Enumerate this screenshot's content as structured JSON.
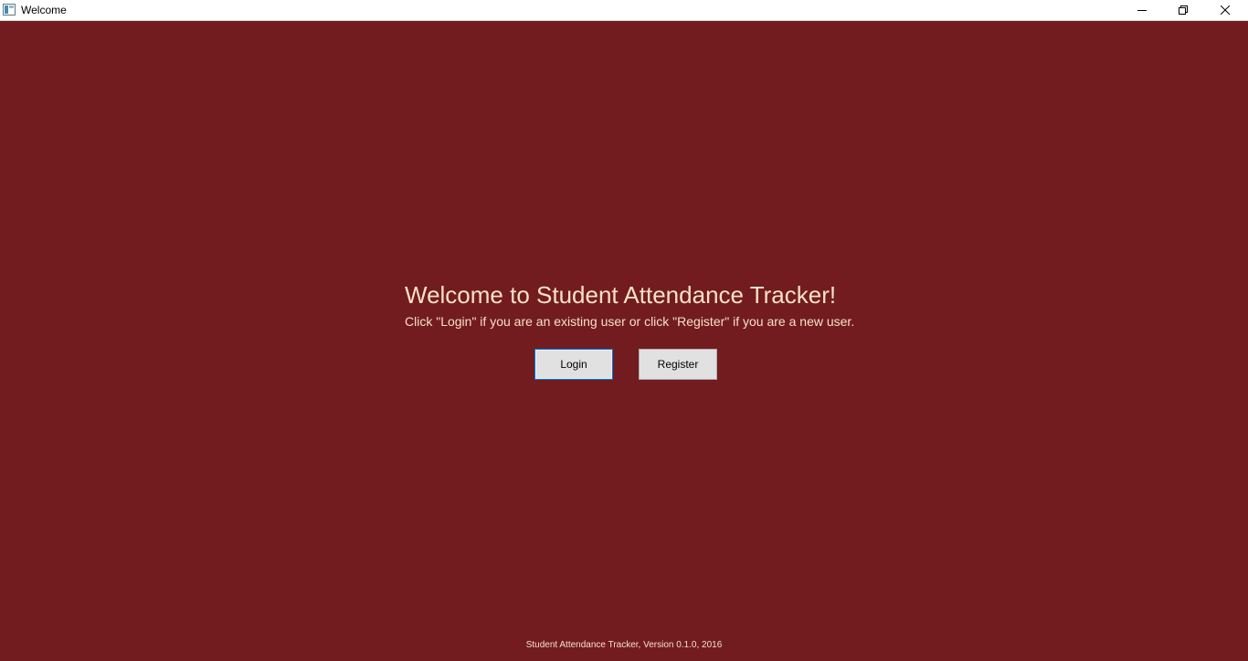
{
  "window": {
    "title": "Welcome",
    "background_color": "#721c20",
    "text_color": "#f7e1c6"
  },
  "titlebar": {
    "icon": "app-window-icon",
    "buttons": [
      "minimize-icon",
      "restore-icon",
      "close-icon"
    ]
  },
  "main": {
    "title": "Welcome to Student Attendance Tracker!",
    "subtitle": "Click \"Login\" if you are an existing user or click \"Register\" if you are a new user.",
    "login_label": "Login",
    "register_label": "Register"
  },
  "footer": {
    "text": "Student Attendance Tracker, Version 0.1.0, 2016"
  }
}
